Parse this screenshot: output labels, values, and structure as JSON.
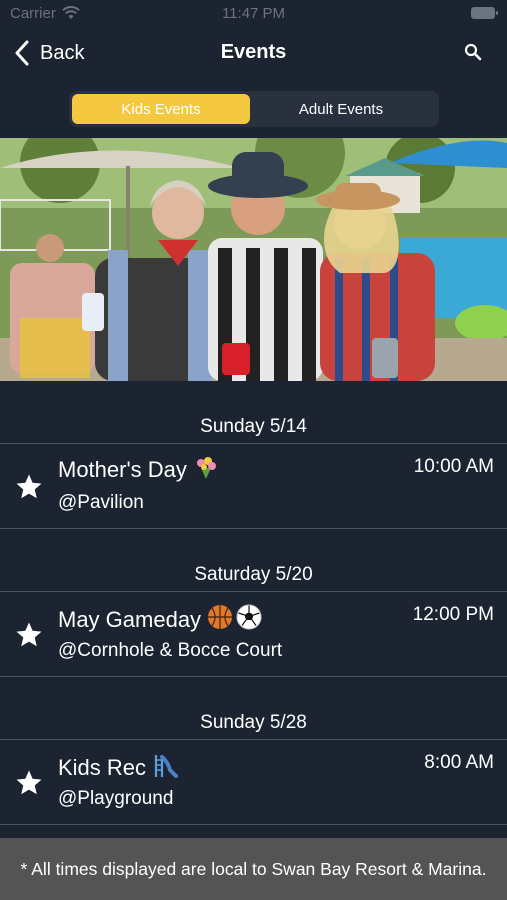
{
  "status_bar": {
    "carrier": "Carrier",
    "time": "11:47 PM"
  },
  "nav": {
    "back_label": "Back",
    "title": "Events",
    "search_icon": "magnifier-icon"
  },
  "tabs": [
    {
      "label": "Kids Events",
      "selected": true
    },
    {
      "label": "Adult Events",
      "selected": false
    }
  ],
  "colors": {
    "background": "#1c2331",
    "accent": "#f5c842",
    "footer": "#545454",
    "divider": "#4a5160"
  },
  "sections": [
    {
      "date": "Sunday 5/14",
      "event": {
        "title": "Mother's Day",
        "emoji": "bouquet",
        "location": "@Pavilion",
        "time": "10:00 AM"
      }
    },
    {
      "date": "Saturday 5/20",
      "event": {
        "title": "May Gameday",
        "emoji": "basketball, soccer-ball",
        "location": "@Cornhole & Bocce Court",
        "time": "12:00 PM"
      }
    },
    {
      "date": "Sunday 5/28",
      "event": {
        "title": "Kids Rec",
        "emoji": "slide",
        "location": "@Playground",
        "time": "8:00 AM"
      }
    }
  ],
  "footer": {
    "note": "* All times displayed are local to Swan Bay Resort & Marina."
  }
}
